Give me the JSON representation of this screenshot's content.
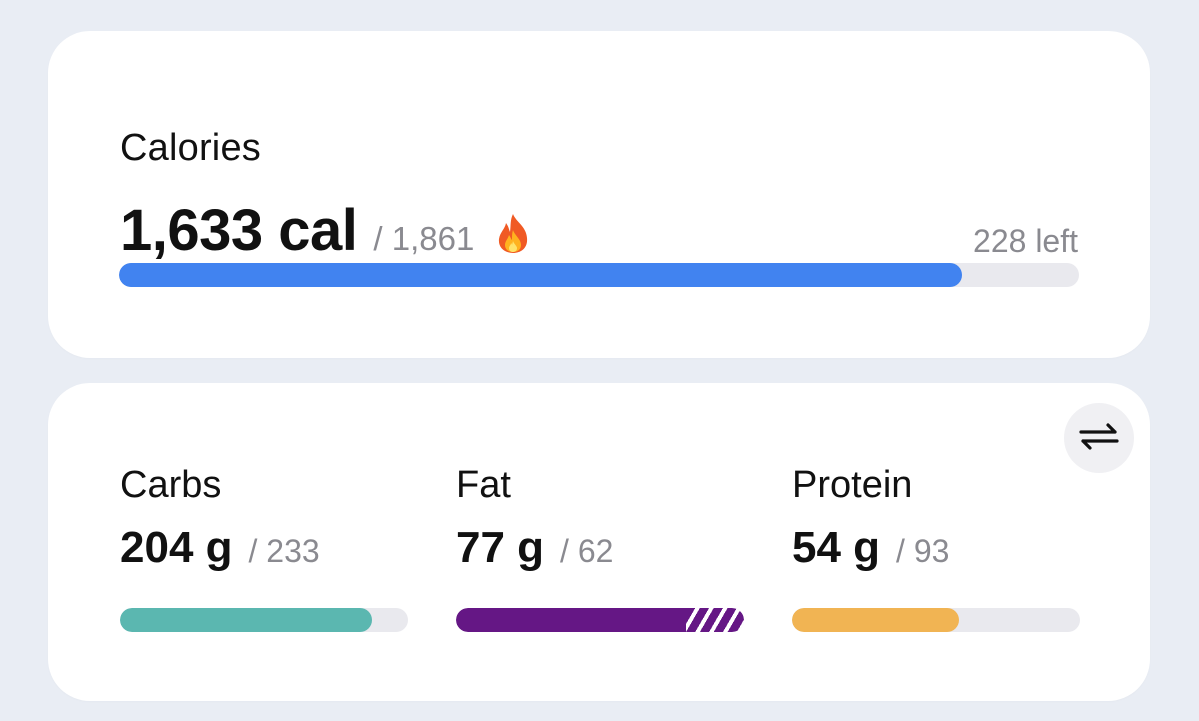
{
  "calories": {
    "title": "Calories",
    "consumed": "1,633 cal",
    "goal": "/ 1,861",
    "left": "228 left",
    "progress": 0.878,
    "bar_color": "#4183f0"
  },
  "macros": {
    "items": [
      {
        "label": "Carbs",
        "value": "204 g",
        "goal": "/ 233",
        "progress": 0.876,
        "over": 0,
        "color": "#5bb7b0"
      },
      {
        "label": "Fat",
        "value": "77 g",
        "goal": "/ 62",
        "progress": 0.8,
        "over": 0.2,
        "color": "#651785"
      },
      {
        "label": "Protein",
        "value": "54 g",
        "goal": "/ 93",
        "progress": 0.58,
        "over": 0,
        "color": "#f1b453"
      }
    ]
  },
  "icons": {
    "flame": "flame-icon",
    "swap": "swap-arrows-icon"
  }
}
